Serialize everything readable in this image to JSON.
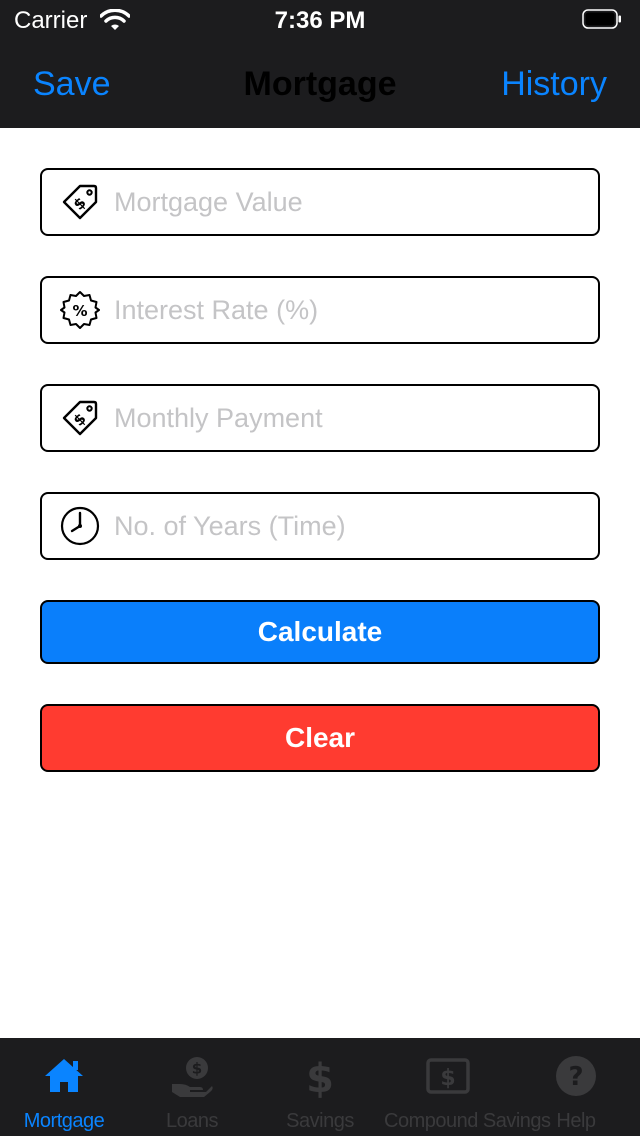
{
  "status_bar": {
    "carrier": "Carrier",
    "time": "7:36 PM"
  },
  "nav": {
    "left_button": "Save",
    "title": "Mortgage",
    "right_button": "History"
  },
  "form": {
    "mortgage_value": {
      "placeholder": "Mortgage Value",
      "value": "",
      "icon": "price-tag-dollar-icon"
    },
    "interest_rate": {
      "placeholder": "Interest Rate (%)",
      "value": "",
      "icon": "percent-badge-icon"
    },
    "monthly_payment": {
      "placeholder": "Monthly Payment",
      "value": "",
      "icon": "price-tag-dollar-icon"
    },
    "years": {
      "placeholder": "No. of Years (Time)",
      "value": "",
      "icon": "clock-icon"
    }
  },
  "buttons": {
    "calculate": "Calculate",
    "clear": "Clear"
  },
  "colors": {
    "accent": "#0a84ff",
    "calculate_bg": "#0a7ffb",
    "clear_bg": "#ff3b30",
    "bar_bg": "#1c1c1e",
    "inactive_tab": "#3a3a3c"
  },
  "tab_bar": {
    "active": "Mortgage",
    "tabs": [
      {
        "label": "Mortgage",
        "icon": "house-icon"
      },
      {
        "label": "Loans",
        "icon": "hand-coin-icon"
      },
      {
        "label": "Savings",
        "icon": "dollar-sign-icon"
      },
      {
        "label": "Compound Savings",
        "icon": "dollar-bill-icon"
      },
      {
        "label": "Help",
        "icon": "question-circle-icon"
      }
    ]
  }
}
